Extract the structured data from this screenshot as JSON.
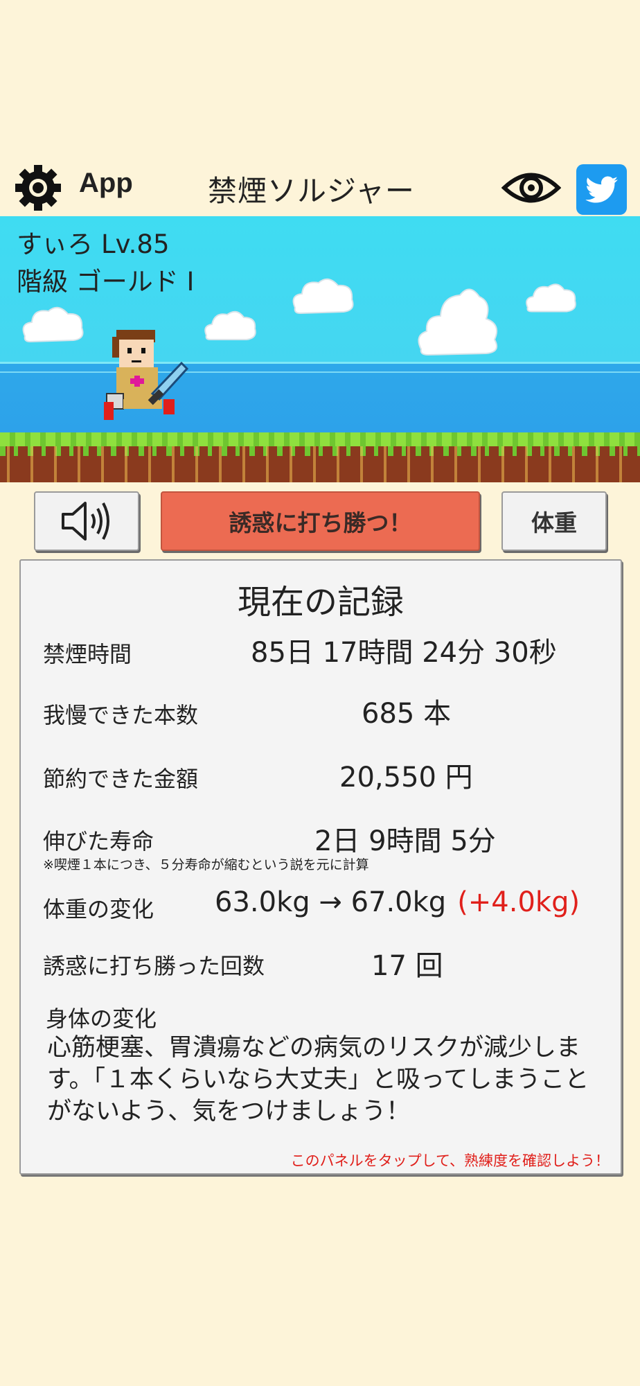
{
  "header": {
    "app_label": "App",
    "title": "禁煙ソルジャー",
    "icons": [
      "gear-icon",
      "eye-icon",
      "twitter-icon"
    ],
    "twitter_color": "#1d9bf0"
  },
  "player": {
    "name_level": "すぃろ Lv.85",
    "rank": "階級 ゴールド I"
  },
  "buttons": {
    "sound_icon": "speaker-icon",
    "win_label": "誘惑に打ち勝つ！",
    "weight_label": "体重",
    "win_color": "#ec6b52"
  },
  "record": {
    "title": "現在の記録",
    "rows": [
      {
        "label": "禁煙時間",
        "value": "85日 17時間 24分 30秒"
      },
      {
        "label": "我慢できた本数",
        "value": "685 本"
      },
      {
        "label": "節約できた金額",
        "value": "20,550 円"
      },
      {
        "label": "伸びた寿命",
        "value": "2日 9時間 5分"
      },
      {
        "label": "体重の変化",
        "value": "63.0kg → 67.0kg",
        "delta": "(+4.0kg)"
      },
      {
        "label": "誘惑に打ち勝った回数",
        "value": "17 回"
      }
    ],
    "lifespan_note": "※喫煙１本につき、５分寿命が縮むという説を元に計算",
    "body_change_title": "身体の変化",
    "body_change_text": "心筋梗塞、胃潰瘍などの病気のリスクが減少します。「１本くらいなら大丈夫」と吸ってしまうことがないよう、気をつけましょう！",
    "tap_hint": "このパネルをタップして、熟練度を確認しよう！",
    "delta_color": "#e0201b"
  }
}
